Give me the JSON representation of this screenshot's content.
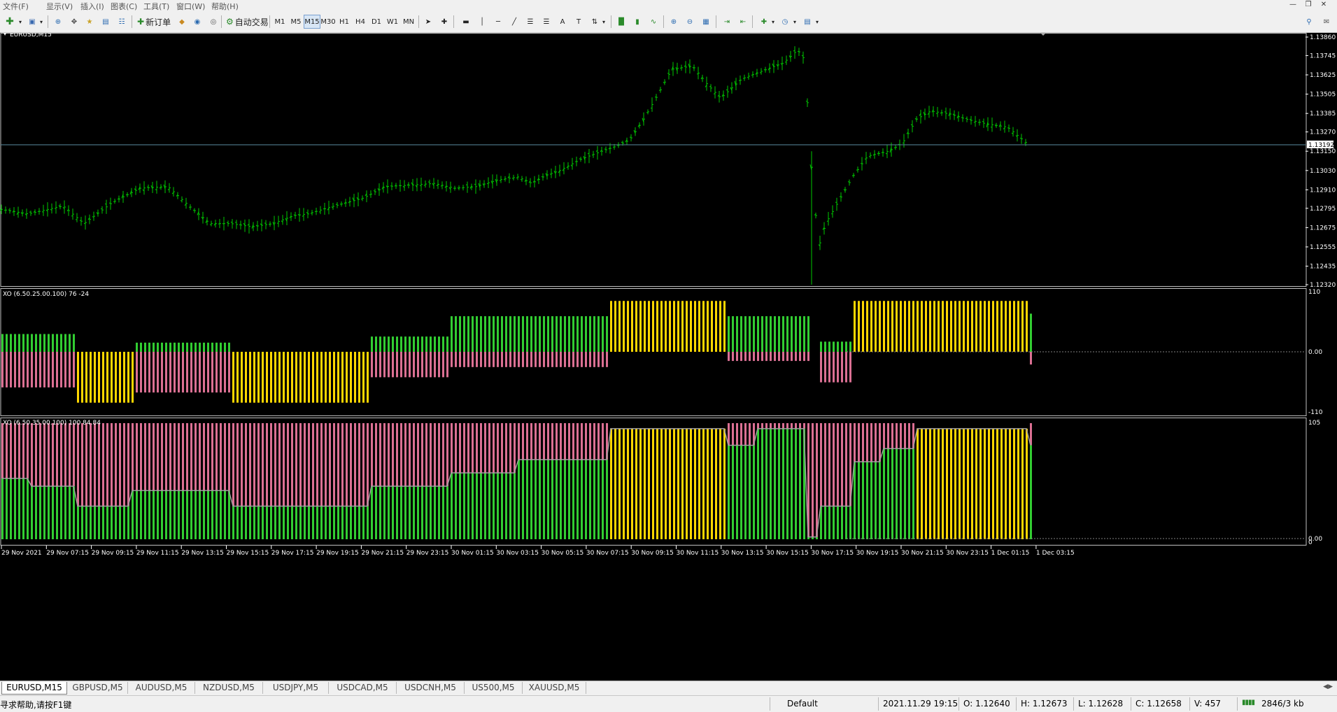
{
  "menu": [
    "文件(F)",
    "显示(V)",
    "插入(I)",
    "图表(C)",
    "工具(T)",
    "窗口(W)",
    "帮助(H)"
  ],
  "toolbar": {
    "new_order": "新订单",
    "auto_trade": "自动交易",
    "timeframes": [
      "M1",
      "M5",
      "M15",
      "M30",
      "H1",
      "H4",
      "D1",
      "W1",
      "MN"
    ],
    "active_timeframe": "M15",
    "draw_text_a": "A",
    "draw_text_t": "T"
  },
  "chart": {
    "symbol_label": "EURUSD,M15",
    "price_labels": [
      "1.13860",
      "1.13745",
      "1.13625",
      "1.13505",
      "1.13385",
      "1.13270",
      "1.13150",
      "1.13030",
      "1.12910",
      "1.12795",
      "1.12675",
      "1.12555",
      "1.12435",
      "1.12320"
    ],
    "current_price": "1.13192",
    "price_min": 1.1232,
    "price_max": 1.1386,
    "ind1_label": "XO (6.50.25.00.100) 76 -24",
    "ind1_scale": [
      "110",
      "0.00",
      "-110"
    ],
    "ind2_label": "XO (6.50.35.00.100) 100 84.84",
    "ind2_scale": [
      "105",
      "0.00",
      "0"
    ],
    "time_labels": [
      "29 Nov 2021",
      "29 Nov 07:15",
      "29 Nov 09:15",
      "29 Nov 11:15",
      "29 Nov 13:15",
      "29 Nov 15:15",
      "29 Nov 17:15",
      "29 Nov 19:15",
      "29 Nov 21:15",
      "29 Nov 23:15",
      "30 Nov 01:15",
      "30 Nov 03:15",
      "30 Nov 05:15",
      "30 Nov 07:15",
      "30 Nov 09:15",
      "30 Nov 11:15",
      "30 Nov 13:15",
      "30 Nov 15:15",
      "30 Nov 17:15",
      "30 Nov 19:15",
      "30 Nov 21:15",
      "30 Nov 23:15",
      "1 Dec 01:15",
      "1 Dec 03:15"
    ],
    "colors": {
      "bar": "#00c800",
      "green": "#32cd32",
      "pink": "#db7093",
      "gold": "#ffd700",
      "grid_line": "#5a8ca0",
      "text": "#ffffff"
    }
  },
  "tabs": [
    "EURUSD,M15",
    "GBPUSD,M5",
    "AUDUSD,M5",
    "NZDUSD,M5",
    "USDJPY,M5",
    "USDCAD,M5",
    "USDCNH,M5",
    "US500,M5",
    "XAUUSD,M5"
  ],
  "status": {
    "help": "寻求帮助,请按F1键",
    "profile": "Default",
    "datetime": "2021.11.29 19:15",
    "open": "O: 1.12640",
    "high": "H: 1.12673",
    "low": "L: 1.12628",
    "close": "C: 1.12658",
    "volume": "V: 457",
    "traffic": "2846/3 kb"
  }
}
